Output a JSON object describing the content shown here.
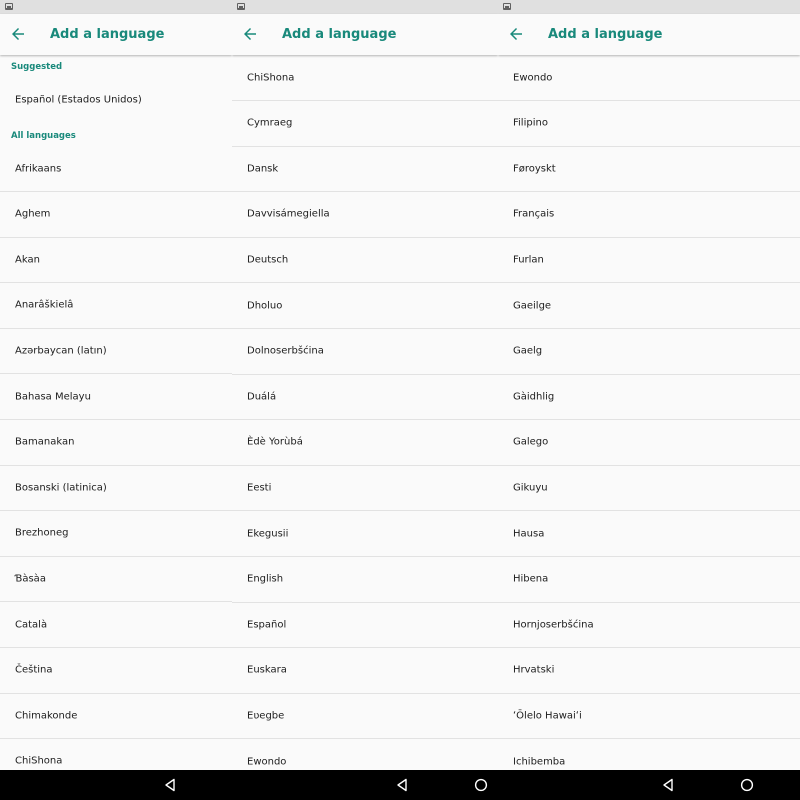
{
  "panels": [
    {
      "title": "Add a language",
      "suggested_label": "Suggested",
      "suggested": [
        "Español (Estados Unidos)"
      ],
      "all_label": "All languages",
      "items": [
        "Afrikaans",
        "Aghem",
        "Akan",
        "Anarâškielâ",
        "Azərbaycan (latın)",
        "Bahasa Melayu",
        "Bamanakan",
        "Bosanski (latinica)",
        "Brezhoneg",
        "Ɓàsàa",
        "Català",
        "Čeština",
        "Chimakonde",
        "ChiShona"
      ]
    },
    {
      "title": "Add a language",
      "items": [
        "ChiShona",
        "Cymraeg",
        "Dansk",
        "Davvisámegiella",
        "Deutsch",
        "Dholuo",
        "Dolnoserbšćina",
        "Duálá",
        "Èdè Yorùbá",
        "Eesti",
        "Ekegusii",
        "English",
        "Español",
        "Euskara",
        "Eʋegbe",
        "Ewondo"
      ]
    },
    {
      "title": "Add a language",
      "items": [
        "Ewondo",
        "Filipino",
        "Føroyskt",
        "Français",
        "Furlan",
        "Gaeilge",
        "Gaelg",
        "Gàidhlig",
        "Galego",
        "Gikuyu",
        "Hausa",
        "Hibena",
        "Hornjoserbšćina",
        "Hrvatski",
        "ʻŌlelo Hawaiʻi",
        "Ichibemba"
      ]
    }
  ],
  "colors": {
    "accent": "#19897b",
    "statusbar": "#e0e0e0",
    "navbar": "#000000"
  },
  "icons": {
    "back": "arrow-back-icon",
    "status": "image-icon",
    "nav_back": "nav-back-icon",
    "nav_home": "nav-home-icon"
  }
}
